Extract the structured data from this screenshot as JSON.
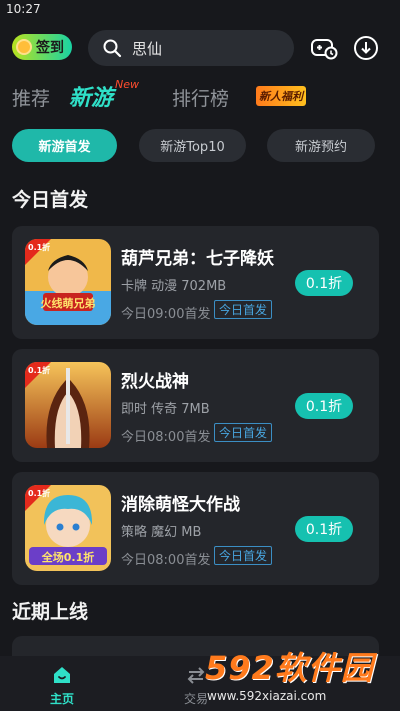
{
  "status_bar": {
    "time": "10:27"
  },
  "top_bar": {
    "signin_label": "签到",
    "search_text": "思仙",
    "icons": [
      "gamepad-history-icon",
      "download-icon"
    ]
  },
  "nav_tabs": [
    {
      "label": "推荐",
      "active": false
    },
    {
      "label": "新游",
      "active": true,
      "badge": "New"
    },
    {
      "label": "排行榜",
      "active": false
    }
  ],
  "welfare_badge": "新人福利",
  "sub_tabs": [
    {
      "label": "新游首发",
      "active": true
    },
    {
      "label": "新游Top10",
      "active": false
    },
    {
      "label": "新游预约",
      "active": false
    }
  ],
  "sections": {
    "today": "今日首发",
    "upcoming": "近期上线"
  },
  "games": [
    {
      "name": "葫芦兄弟：七子降妖",
      "meta": "卡牌 动漫 702MB",
      "time": "今日09:00首发",
      "tag": "今日首发",
      "discount": "0.1折",
      "icon_badge": "0.1折",
      "icon_caption": "火线萌兄弟"
    },
    {
      "name": "烈火战神",
      "meta": "即时 传奇 7MB",
      "time": "今日08:00首发",
      "tag": "今日首发",
      "discount": "0.1折",
      "icon_badge": "0.1折"
    },
    {
      "name": "消除萌怪大作战",
      "meta": "策略 魔幻 MB",
      "time": "今日08:00首发",
      "tag": "今日首发",
      "discount": "0.1折",
      "icon_badge": "0.1折",
      "icon_caption": "全场0.1折"
    }
  ],
  "bottom_nav": [
    {
      "label": "主页",
      "active": true,
      "icon": "home-icon"
    },
    {
      "label": "交易",
      "active": false,
      "icon": "trade-icon"
    }
  ],
  "watermark": {
    "logo": "592软件园",
    "url": "www.592xiazai.com"
  },
  "colors": {
    "accent": "#2fe0c8",
    "button": "#16c1b0",
    "background": "#17181c",
    "card": "#24262b",
    "tag": "#49a6e0"
  }
}
